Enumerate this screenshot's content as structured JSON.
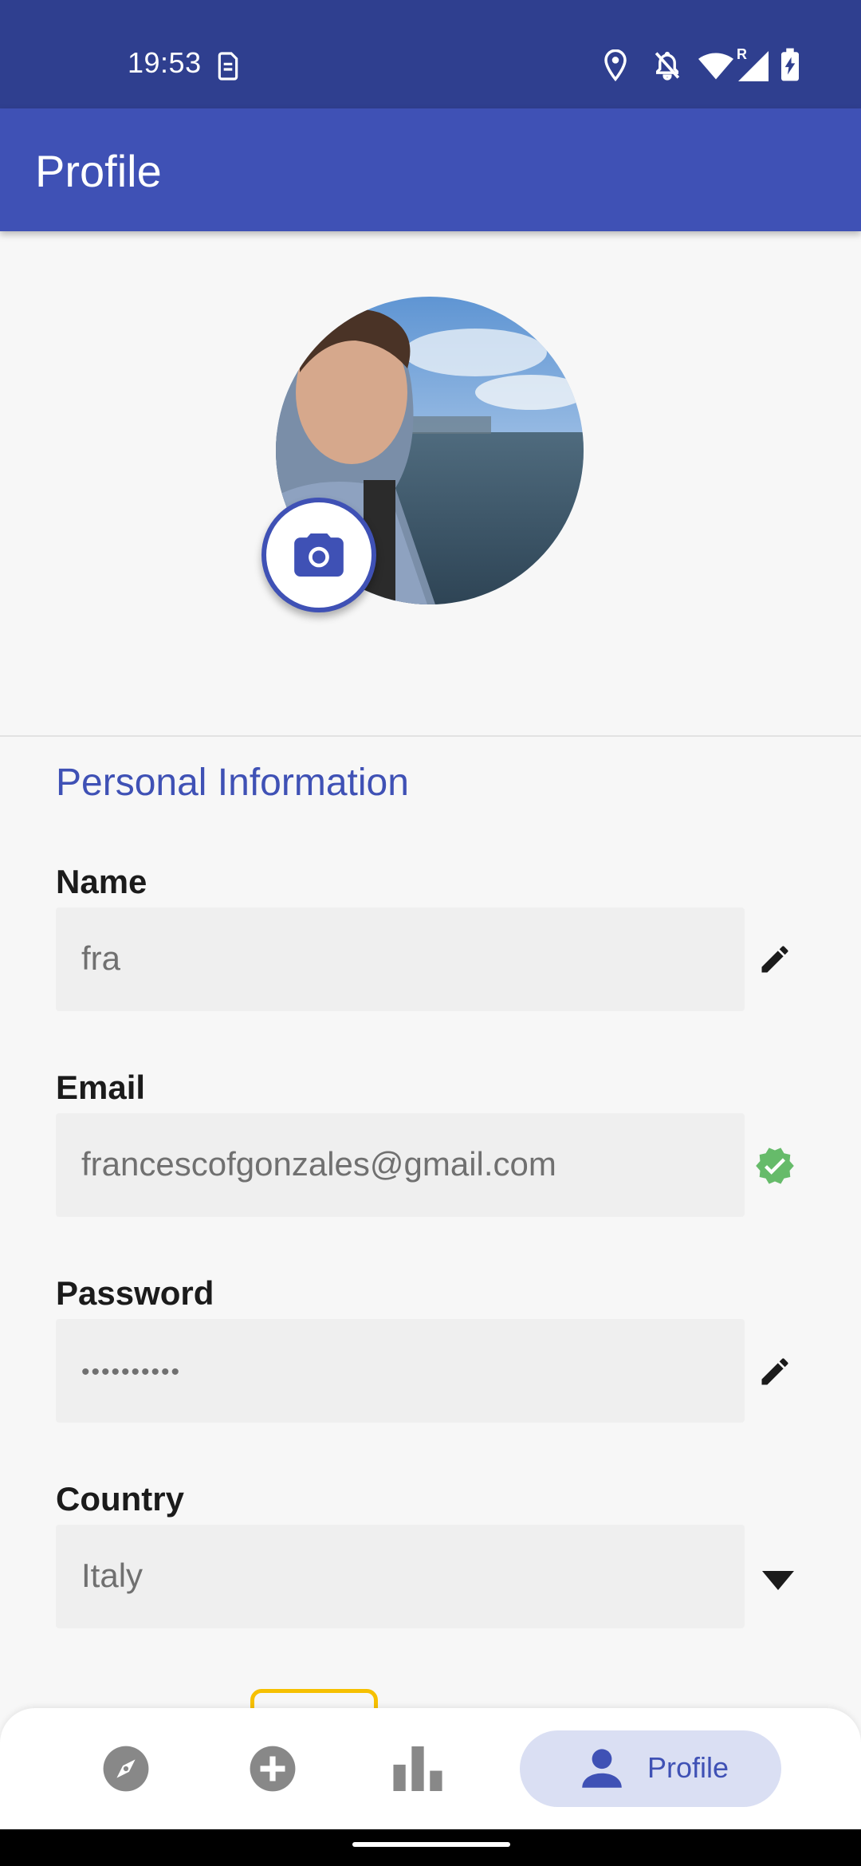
{
  "status_bar": {
    "time": "19:53",
    "icons": [
      "sim-card-icon",
      "location-icon",
      "notifications-off-icon",
      "wifi-icon",
      "roaming-indicator",
      "signal-icon",
      "battery-charging-icon"
    ],
    "roaming_label": "R"
  },
  "app_bar": {
    "title": "Profile"
  },
  "avatar": {
    "action_icon": "camera-icon"
  },
  "section": {
    "title": "Personal Information"
  },
  "fields": {
    "name": {
      "label": "Name",
      "value": "fra",
      "action_icon": "edit-icon"
    },
    "email": {
      "label": "Email",
      "value": "francescofgonzales@gmail.com",
      "status_icon": "verified-icon",
      "status_color": "#66bb6a"
    },
    "password": {
      "label": "Password",
      "value": "••••••••••",
      "action_icon": "edit-icon"
    },
    "country": {
      "label": "Country",
      "value": "Italy",
      "action_icon": "dropdown-arrow-icon"
    }
  },
  "bottom_nav": {
    "items": [
      {
        "icon": "explore-icon"
      },
      {
        "icon": "add-circle-icon"
      },
      {
        "icon": "bar-chart-icon"
      },
      {
        "icon": "person-icon",
        "label": "Profile",
        "active": true
      }
    ]
  },
  "colors": {
    "status_bar": "#2f3f8f",
    "primary": "#3f51b5",
    "nav_active_bg": "#dadff3",
    "badge_border": "#f6c000"
  }
}
